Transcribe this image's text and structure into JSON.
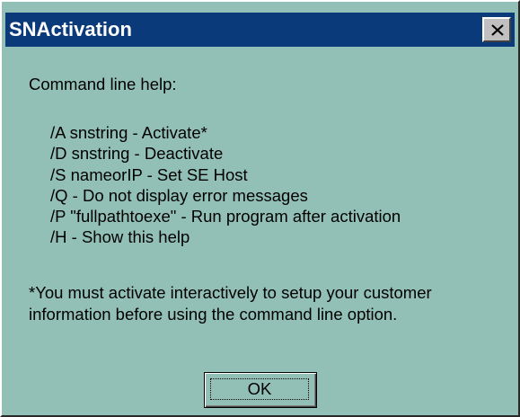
{
  "window": {
    "title": "SNActivation"
  },
  "dialog": {
    "heading": "Command line help:",
    "options": [
      "/A snstring - Activate*",
      "/D snstring - Deactivate",
      "/S nameorIP - Set SE Host",
      "/Q - Do not display error messages",
      "/P \"fullpathtoexe\" - Run program after activation",
      "/H - Show this help"
    ],
    "footnote": "*You must activate interactively to setup your customer information before using the command line option.",
    "ok_label": "OK"
  },
  "icons": {
    "close": "close-icon"
  },
  "colors": {
    "titlebar": "#0a3a7a",
    "background": "#92c0b6"
  }
}
